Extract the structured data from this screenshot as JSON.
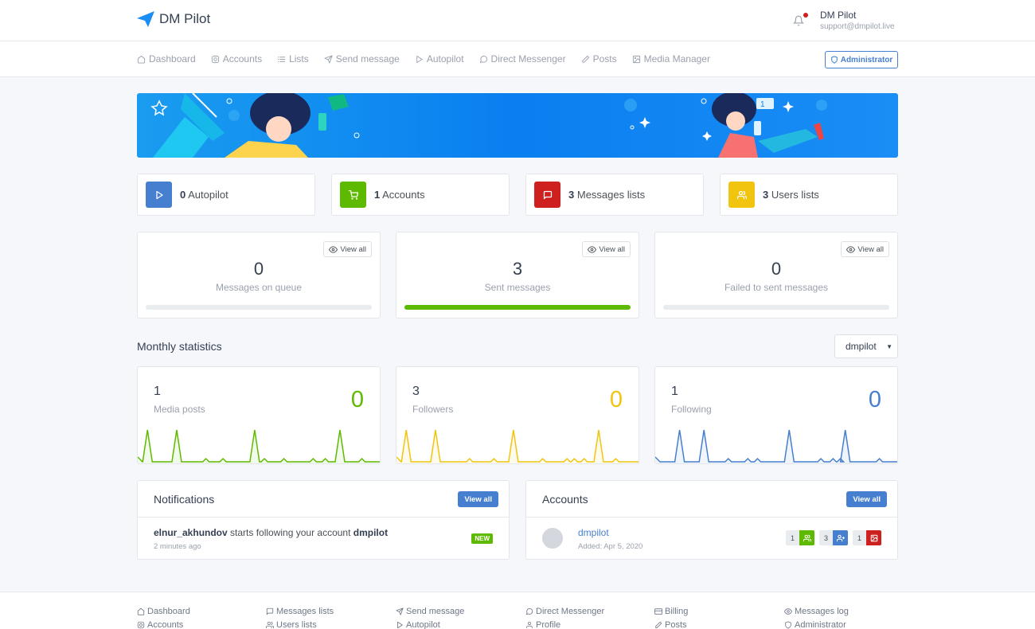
{
  "brand": {
    "name": "DM Pilot"
  },
  "user": {
    "name": "DM Pilot",
    "email": "support@dmpilot.live"
  },
  "nav": {
    "items": [
      {
        "label": "Dashboard",
        "icon": "home-icon"
      },
      {
        "label": "Accounts",
        "icon": "instagram-icon"
      },
      {
        "label": "Lists",
        "icon": "list-icon"
      },
      {
        "label": "Send message",
        "icon": "send-icon"
      },
      {
        "label": "Autopilot",
        "icon": "play-icon"
      },
      {
        "label": "Direct Messenger",
        "icon": "message-circle-icon"
      },
      {
        "label": "Posts",
        "icon": "edit-icon"
      },
      {
        "label": "Media Manager",
        "icon": "image-icon"
      }
    ],
    "admin_label": "Administrator"
  },
  "stats": [
    {
      "count": "0",
      "label": "Autopilot",
      "color": "#467fcf",
      "icon": "play-icon"
    },
    {
      "count": "1",
      "label": "Accounts",
      "color": "#5eba00",
      "icon": "shopping-cart-icon"
    },
    {
      "count": "3",
      "label": "Messages lists",
      "color": "#cd201f",
      "icon": "message-square-icon"
    },
    {
      "count": "3",
      "label": "Users lists",
      "color": "#f1c40f",
      "icon": "users-icon"
    }
  ],
  "messages": [
    {
      "value": "0",
      "label": "Messages on queue",
      "view_all": "View all",
      "progress": 0
    },
    {
      "value": "3",
      "label": "Sent messages",
      "view_all": "View all",
      "progress": 1
    },
    {
      "value": "0",
      "label": "Failed to sent messages",
      "view_all": "View all",
      "progress": 0
    }
  ],
  "monthly": {
    "title": "Monthly statistics",
    "account_select": "dmpilot",
    "cards": [
      {
        "value": "1",
        "label": "Media posts",
        "delta": "0",
        "color": "#5eba00"
      },
      {
        "value": "3",
        "label": "Followers",
        "delta": "0",
        "color": "#f1c40f"
      },
      {
        "value": "1",
        "label": "Following",
        "delta": "0",
        "color": "#467fcf"
      }
    ]
  },
  "notifications": {
    "title": "Notifications",
    "view_all": "View all",
    "item": {
      "user": "elnur_akhundov",
      "text": " starts following your account ",
      "account": "dmpilot",
      "time": "2 minutes ago",
      "badge": "NEW"
    }
  },
  "accounts": {
    "title": "Accounts",
    "view_all": "View all",
    "item": {
      "name": "dmpilot",
      "added": "Added: Apr 5, 2020",
      "tags": [
        {
          "count": "1",
          "color": "#5eba00",
          "icon": "users-icon"
        },
        {
          "count": "3",
          "color": "#467fcf",
          "icon": "user-plus-icon"
        },
        {
          "count": "1",
          "color": "#cd201f",
          "icon": "image-icon"
        }
      ]
    }
  },
  "footer": {
    "links": [
      {
        "label": "Dashboard",
        "icon": "home-icon"
      },
      {
        "label": "Accounts",
        "icon": "instagram-icon"
      },
      {
        "label": "Messages lists",
        "icon": "message-square-icon"
      },
      {
        "label": "Users lists",
        "icon": "users-icon"
      },
      {
        "label": "Send message",
        "icon": "send-icon"
      },
      {
        "label": "Autopilot",
        "icon": "play-icon"
      },
      {
        "label": "Direct Messenger",
        "icon": "message-circle-icon"
      },
      {
        "label": "Profile",
        "icon": "user-icon"
      },
      {
        "label": "Billing",
        "icon": "credit-card-icon"
      },
      {
        "label": "Posts",
        "icon": "edit-icon"
      },
      {
        "label": "Messages log",
        "icon": "eye-icon"
      },
      {
        "label": "Administrator",
        "icon": "shield-icon"
      }
    ]
  }
}
